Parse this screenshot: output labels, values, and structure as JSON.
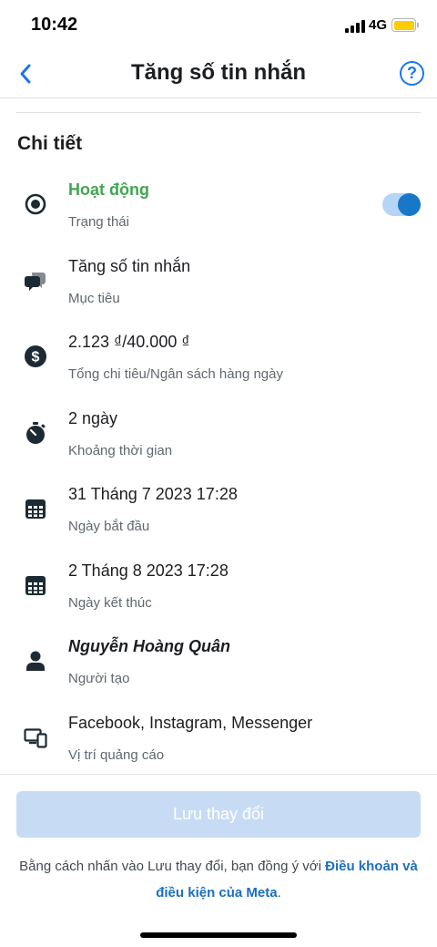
{
  "status_bar": {
    "time": "10:42",
    "network": "4G"
  },
  "nav": {
    "title": "Tăng số tin nhắn",
    "back_icon": "chevron-left-icon",
    "help_label": "?"
  },
  "section_title": "Chi tiết",
  "details": [
    {
      "icon": "radio-target-icon",
      "value": "Hoạt động",
      "caption": "Trạng thái",
      "toggle_on": true
    },
    {
      "icon": "chat-bubbles-icon",
      "value": "Tăng số tin nhắn",
      "caption": "Mục tiêu"
    },
    {
      "icon": "dollar-icon",
      "value": "2.123 ₫/40.000 ₫",
      "caption": "Tổng chi tiêu/Ngân sách hàng ngày"
    },
    {
      "icon": "stopwatch-icon",
      "value": "2 ngày",
      "caption": "Khoảng thời gian"
    },
    {
      "icon": "calendar-icon",
      "value": "31 Tháng 7 2023 17:28",
      "caption": "Ngày bắt đầu"
    },
    {
      "icon": "calendar-icon",
      "value": "2 Tháng 8 2023 17:28",
      "caption": "Ngày kết thúc"
    },
    {
      "icon": "person-icon",
      "value": "Nguyễn Hoàng Quân",
      "caption": "Người tạo"
    },
    {
      "icon": "devices-icon",
      "value": "Facebook, Instagram, Messenger",
      "caption": "Vị trí quảng cáo"
    }
  ],
  "save_button": {
    "label": "Lưu thay đổi",
    "enabled": false
  },
  "terms": {
    "prefix": "Bằng cách nhấn vào Lưu thay đổi, bạn đồng ý với ",
    "link": "Điều khoản và điều kiện của Meta",
    "suffix": "."
  },
  "colors": {
    "accent": "#1877f2",
    "status_active": "#42a652",
    "toggle_track": "#b6d4f6",
    "toggle_knob": "#1877c8",
    "disabled_button": "#c7dcf4",
    "link": "#1b6fbf"
  }
}
